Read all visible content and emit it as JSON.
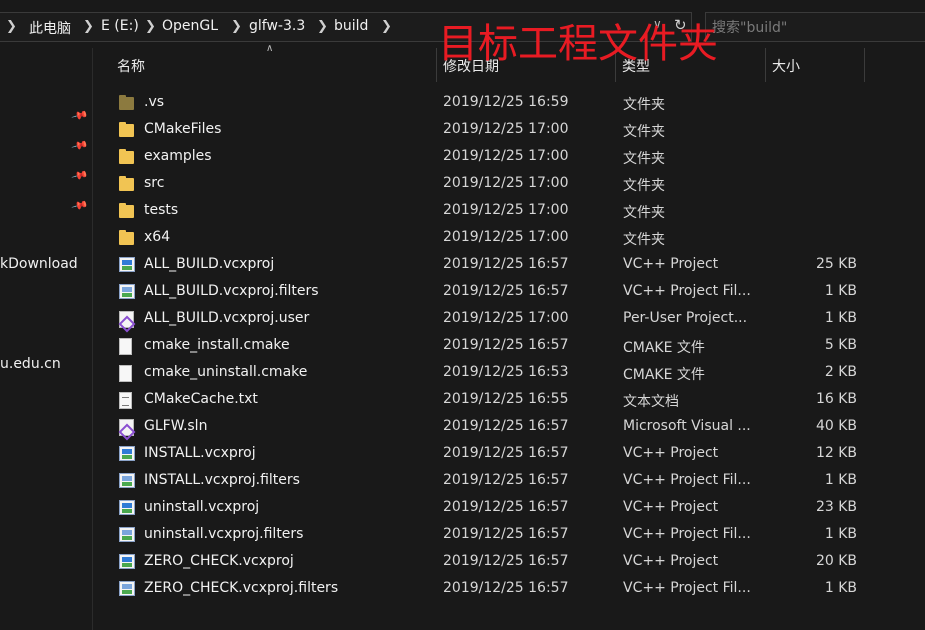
{
  "breadcrumb": [
    "此电脑",
    "E (E:)",
    "OpenGL",
    "glfw-3.3",
    "build"
  ],
  "search": {
    "placeholder": "搜索\"build\""
  },
  "annotation": "目标工程文件夹",
  "nav": {
    "items": [
      "kDownload",
      "u.edu.cn"
    ]
  },
  "columns": {
    "name": "名称",
    "date": "修改日期",
    "type": "类型",
    "size": "大小"
  },
  "files": [
    {
      "name": ".vs",
      "date": "2019/12/25 16:59",
      "type": "文件夹",
      "size": "",
      "icon": "folder-hidden-icon"
    },
    {
      "name": "CMakeFiles",
      "date": "2019/12/25 17:00",
      "type": "文件夹",
      "size": "",
      "icon": "folder-icon"
    },
    {
      "name": "examples",
      "date": "2019/12/25 17:00",
      "type": "文件夹",
      "size": "",
      "icon": "folder-icon"
    },
    {
      "name": "src",
      "date": "2019/12/25 17:00",
      "type": "文件夹",
      "size": "",
      "icon": "folder-icon"
    },
    {
      "name": "tests",
      "date": "2019/12/25 17:00",
      "type": "文件夹",
      "size": "",
      "icon": "folder-icon"
    },
    {
      "name": "x64",
      "date": "2019/12/25 17:00",
      "type": "文件夹",
      "size": "",
      "icon": "folder-icon"
    },
    {
      "name": "ALL_BUILD.vcxproj",
      "date": "2019/12/25 16:57",
      "type": "VC++ Project",
      "size": "25 KB",
      "icon": "vcxproj-icon"
    },
    {
      "name": "ALL_BUILD.vcxproj.filters",
      "date": "2019/12/25 16:57",
      "type": "VC++ Project Fil...",
      "size": "1 KB",
      "icon": "vcxproj-filters-icon"
    },
    {
      "name": "ALL_BUILD.vcxproj.user",
      "date": "2019/12/25 17:00",
      "type": "Per-User Project...",
      "size": "1 KB",
      "icon": "visual-studio-icon"
    },
    {
      "name": "cmake_install.cmake",
      "date": "2019/12/25 16:57",
      "type": "CMAKE 文件",
      "size": "5 KB",
      "icon": "document-icon"
    },
    {
      "name": "cmake_uninstall.cmake",
      "date": "2019/12/25 16:53",
      "type": "CMAKE 文件",
      "size": "2 KB",
      "icon": "document-icon"
    },
    {
      "name": "CMakeCache.txt",
      "date": "2019/12/25 16:55",
      "type": "文本文档",
      "size": "16 KB",
      "icon": "text-file-icon"
    },
    {
      "name": "GLFW.sln",
      "date": "2019/12/25 16:57",
      "type": "Microsoft Visual ...",
      "size": "40 KB",
      "icon": "visual-studio-icon"
    },
    {
      "name": "INSTALL.vcxproj",
      "date": "2019/12/25 16:57",
      "type": "VC++ Project",
      "size": "12 KB",
      "icon": "vcxproj-icon"
    },
    {
      "name": "INSTALL.vcxproj.filters",
      "date": "2019/12/25 16:57",
      "type": "VC++ Project Fil...",
      "size": "1 KB",
      "icon": "vcxproj-filters-icon"
    },
    {
      "name": "uninstall.vcxproj",
      "date": "2019/12/25 16:57",
      "type": "VC++ Project",
      "size": "23 KB",
      "icon": "vcxproj-icon"
    },
    {
      "name": "uninstall.vcxproj.filters",
      "date": "2019/12/25 16:57",
      "type": "VC++ Project Fil...",
      "size": "1 KB",
      "icon": "vcxproj-filters-icon"
    },
    {
      "name": "ZERO_CHECK.vcxproj",
      "date": "2019/12/25 16:57",
      "type": "VC++ Project",
      "size": "20 KB",
      "icon": "vcxproj-icon"
    },
    {
      "name": "ZERO_CHECK.vcxproj.filters",
      "date": "2019/12/25 16:57",
      "type": "VC++ Project Fil...",
      "size": "1 KB",
      "icon": "vcxproj-filters-icon"
    }
  ],
  "colors": {
    "annotation": "#e81b23",
    "folder": "#f1c453",
    "background": "#191919"
  }
}
